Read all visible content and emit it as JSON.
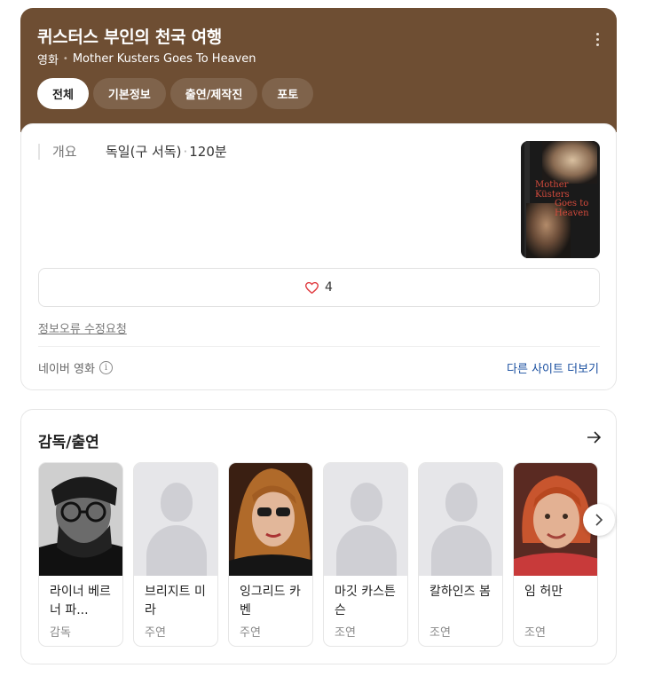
{
  "header": {
    "title": "퀴스터스 부인의 천국 여행",
    "category": "영화",
    "original_title": "Mother Kusters Goes To Heaven",
    "tabs": [
      {
        "label": "전체",
        "active": true
      },
      {
        "label": "기본정보",
        "active": false
      },
      {
        "label": "출연/제작진",
        "active": false
      },
      {
        "label": "포토",
        "active": false
      }
    ],
    "background_color": "#6e4e33"
  },
  "overview": {
    "label": "개요",
    "country": "독일(구 서독)",
    "runtime": "120분"
  },
  "poster": {
    "text_line1": "Mother",
    "text_line2": "Küsters",
    "text_line3": "Goes to",
    "text_line4": "Heaven"
  },
  "like": {
    "icon": "heart-outline-icon",
    "count": "4"
  },
  "report_link": "정보오류 수정요청",
  "source": {
    "label": "네이버 영화",
    "info_icon": "i"
  },
  "more_sites": "다른 사이트 더보기",
  "cast": {
    "title": "감독/출연",
    "items": [
      {
        "name": "라이너 베르너 파...",
        "role": "감독",
        "photo": "photo"
      },
      {
        "name": "브리지트 미라",
        "role": "주연",
        "photo": "placeholder"
      },
      {
        "name": "잉그리드 카벤",
        "role": "주연",
        "photo": "photo"
      },
      {
        "name": "마깃 카스튼슨",
        "role": "조연",
        "photo": "placeholder"
      },
      {
        "name": "칼하인즈 봄",
        "role": "조연",
        "photo": "placeholder"
      },
      {
        "name": "임 허만",
        "role": "조연",
        "photo": "photo"
      }
    ]
  }
}
